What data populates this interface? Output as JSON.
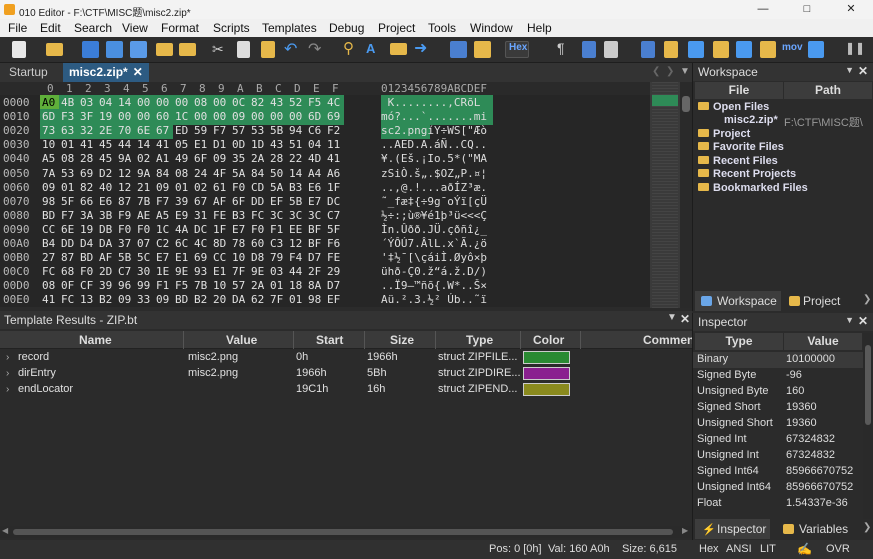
{
  "title": "010 Editor - F:\\CTF\\MISC题\\misc2.zip*",
  "menu": [
    "File",
    "Edit",
    "Search",
    "View",
    "Format",
    "Scripts",
    "Templates",
    "Debug",
    "Project",
    "Tools",
    "Window",
    "Help"
  ],
  "toolbar": {
    "hex_label": "Hex",
    "mov_label": "mov"
  },
  "tabs": {
    "startup": "Startup",
    "file": "misc2.zip*"
  },
  "hex_header": [
    "0",
    "1",
    "2",
    "3",
    "4",
    "5",
    "6",
    "7",
    "8",
    "9",
    "A",
    "B",
    "C",
    "D",
    "E",
    "F"
  ],
  "ascii_header": "0123456789ABCDEF",
  "hex_rows": [
    {
      "addr": "0000",
      "bytes": [
        "A0",
        "4B",
        "03",
        "04",
        "14",
        "00",
        "00",
        "00",
        "08",
        "00",
        "0C",
        "82",
        "43",
        "52",
        "F5",
        "4C"
      ],
      "ascii": " K........,CRõL"
    },
    {
      "addr": "0010",
      "bytes": [
        "6D",
        "F3",
        "3F",
        "19",
        "00",
        "00",
        "60",
        "1C",
        "00",
        "00",
        "09",
        "00",
        "00",
        "00",
        "6D",
        "69"
      ],
      "ascii": "mó?...`.......mi"
    },
    {
      "addr": "0020",
      "bytes": [
        "73",
        "63",
        "32",
        "2E",
        "70",
        "6E",
        "67",
        "ED",
        "59",
        "F7",
        "57",
        "53",
        "5B",
        "94",
        "C6",
        "F2"
      ],
      "ascii": "sc2.pngíY÷WS[\"Æò"
    },
    {
      "addr": "0030",
      "bytes": [
        "10",
        "01",
        "41",
        "45",
        "44",
        "14",
        "41",
        "05",
        "E1",
        "D1",
        "0D",
        "1D",
        "43",
        "51",
        "04",
        "11"
      ],
      "ascii": "..AED.A.áÑ..CQ.."
    },
    {
      "addr": "0040",
      "bytes": [
        "A5",
        "08",
        "28",
        "45",
        "9A",
        "02",
        "A1",
        "49",
        "6F",
        "09",
        "35",
        "2A",
        "28",
        "22",
        "4D",
        "41"
      ],
      "ascii": "¥.(Eš.¡Io.5*(\"MA"
    },
    {
      "addr": "0050",
      "bytes": [
        "7A",
        "53",
        "69",
        "D2",
        "12",
        "9A",
        "84",
        "08",
        "24",
        "4F",
        "5A",
        "84",
        "50",
        "14",
        "A4",
        "A6"
      ],
      "ascii": "zSiÒ.š„.$OZ„P.¤¦"
    },
    {
      "addr": "0060",
      "bytes": [
        "09",
        "01",
        "82",
        "40",
        "12",
        "21",
        "09",
        "01",
        "02",
        "61",
        "F0",
        "CD",
        "5A",
        "B3",
        "E6",
        "1F"
      ],
      "ascii": "..‚@.!...aðÍZ³æ."
    },
    {
      "addr": "0070",
      "bytes": [
        "98",
        "5F",
        "66",
        "E6",
        "87",
        "7B",
        "F7",
        "39",
        "67",
        "AF",
        "6F",
        "DD",
        "EF",
        "5B",
        "E7",
        "DC"
      ],
      "ascii": "˜_fæ‡{÷9g¯oÝï[çÜ"
    },
    {
      "addr": "0080",
      "bytes": [
        "BD",
        "F7",
        "3A",
        "3B",
        "F9",
        "AE",
        "A5",
        "E9",
        "31",
        "FE",
        "B3",
        "FC",
        "3C",
        "3C",
        "3C",
        "C7"
      ],
      "ascii": "½÷:;ù®¥é1þ³ü<<<Ç"
    },
    {
      "addr": "0090",
      "bytes": [
        "CC",
        "6E",
        "19",
        "DB",
        "F0",
        "F0",
        "1C",
        "4A",
        "DC",
        "1F",
        "E7",
        "F0",
        "F1",
        "EE",
        "BF",
        "5F"
      ],
      "ascii": "Ìn.Ûðð.JÜ.çðñî¿_"
    },
    {
      "addr": "00A0",
      "bytes": [
        "B4",
        "DD",
        "D4",
        "DA",
        "37",
        "07",
        "C2",
        "6C",
        "4C",
        "8D",
        "78",
        "60",
        "C3",
        "12",
        "BF",
        "F6"
      ],
      "ascii": "´ÝÔÚ7.ÂlL.x`Ã.¿ö"
    },
    {
      "addr": "00B0",
      "bytes": [
        "27",
        "87",
        "BD",
        "AF",
        "5B",
        "5C",
        "E7",
        "E1",
        "69",
        "CC",
        "10",
        "D8",
        "79",
        "F4",
        "D7",
        "FE"
      ],
      "ascii": "'‡½¯[\\çáiÌ.Øyô×þ"
    },
    {
      "addr": "00C0",
      "bytes": [
        "FC",
        "68",
        "F0",
        "2D",
        "C7",
        "30",
        "1E",
        "9E",
        "93",
        "E1",
        "7F",
        "9E",
        "03",
        "44",
        "2F",
        "29"
      ],
      "ascii": "ühð-Ç0.ž“á.ž.D/)"
    },
    {
      "addr": "00D0",
      "bytes": [
        "08",
        "0F",
        "CF",
        "39",
        "96",
        "99",
        "F1",
        "F5",
        "7B",
        "10",
        "57",
        "2A",
        "01",
        "18",
        "8A",
        "D7"
      ],
      "ascii": "..Ï9–™ñõ{.W*..Š×"
    },
    {
      "addr": "00E0",
      "bytes": [
        "41",
        "FC",
        "13",
        "B2",
        "09",
        "33",
        "09",
        "BD",
        "B2",
        "20",
        "DA",
        "62",
        "7F",
        "01",
        "98",
        "EF"
      ],
      "ascii": "Aü.².3.½² Úb..˜ï"
    }
  ],
  "template": {
    "header": "Template Results - ZIP.bt",
    "columns": [
      "Name",
      "Value",
      "Start",
      "Size",
      "Type",
      "Color",
      "Commen"
    ],
    "rows": [
      {
        "name": "record",
        "value": "misc2.png",
        "start": "0h",
        "size": "1966h",
        "type": "struct ZIPFILE...",
        "color": "#2a8a32"
      },
      {
        "name": "dirEntry",
        "value": "misc2.png",
        "start": "1966h",
        "size": "5Bh",
        "type": "struct ZIPDIRE...",
        "color": "#8a1f8f"
      },
      {
        "name": "endLocator",
        "value": "",
        "start": "19C1h",
        "size": "16h",
        "type": "struct ZIPEND...",
        "color": "#8a8a1e"
      }
    ]
  },
  "workspace": {
    "title": "Workspace",
    "columns": [
      "File",
      "Path"
    ],
    "open_files": "Open Files",
    "open_file_name": "misc2.zip*",
    "open_file_path": "F:\\CTF\\MISC题\\",
    "items": [
      "Project",
      "Favorite Files",
      "Recent Files",
      "Recent Projects",
      "Bookmarked Files"
    ],
    "tabs": [
      "Workspace",
      "Project"
    ]
  },
  "inspector": {
    "title": "Inspector",
    "columns": [
      "Type",
      "Value"
    ],
    "rows": [
      {
        "type": "Binary",
        "value": "10100000"
      },
      {
        "type": "Signed Byte",
        "value": "-96"
      },
      {
        "type": "Unsigned Byte",
        "value": "160"
      },
      {
        "type": "Signed Short",
        "value": "19360"
      },
      {
        "type": "Unsigned Short",
        "value": "19360"
      },
      {
        "type": "Signed Int",
        "value": "67324832"
      },
      {
        "type": "Unsigned Int",
        "value": "67324832"
      },
      {
        "type": "Signed Int64",
        "value": "85966670752"
      },
      {
        "type": "Unsigned Int64",
        "value": "85966670752"
      },
      {
        "type": "Float",
        "value": "1.54337e-36"
      }
    ],
    "tabs": [
      "Inspector",
      "Variables"
    ]
  },
  "status": {
    "pos": "Pos: 0 [0h]",
    "val": "Val: 160 A0h",
    "size": "Size: 6,615",
    "mode": "Hex",
    "enc": "ANSI",
    "endian": "LIT",
    "ovr": "OVR"
  },
  "colors": {
    "hex_bg": "#262626",
    "selected": "#2e8b57",
    "tab_active": "#2d5b82"
  }
}
